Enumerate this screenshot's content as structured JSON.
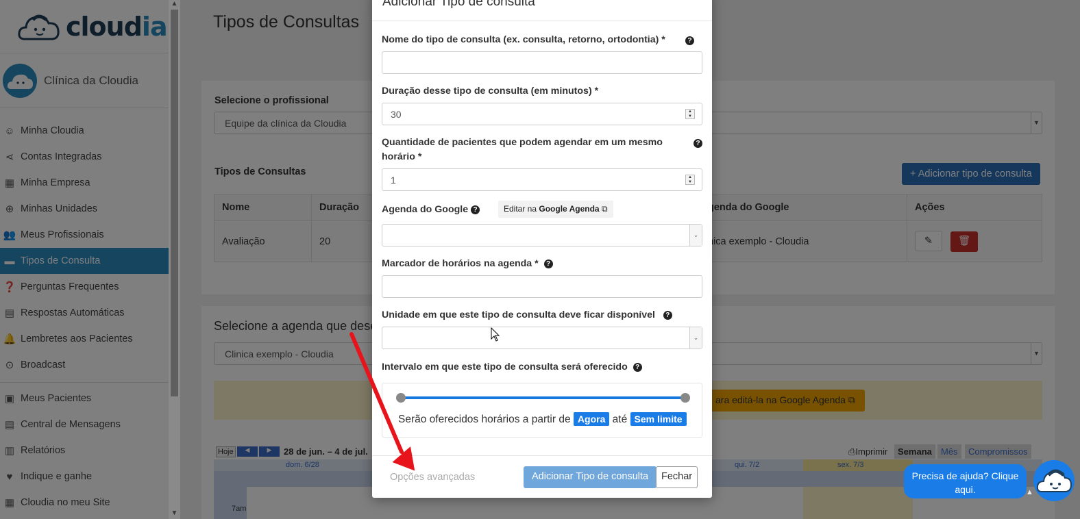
{
  "brand": {
    "name_a": "cloud",
    "name_b": "ia"
  },
  "clinic": {
    "name": "Clínica da Cloudia"
  },
  "menu": [
    {
      "label": "Minha Cloudia",
      "icon": "smiley-icon"
    },
    {
      "label": "Contas Integradas",
      "icon": "share-icon"
    },
    {
      "label": "Minha Empresa",
      "icon": "store-icon"
    },
    {
      "label": "Minhas Unidades",
      "icon": "plus-circle-icon"
    },
    {
      "label": "Meus Profissionais",
      "icon": "people-icon"
    },
    {
      "label": "Tipos de Consulta",
      "icon": "list-icon"
    },
    {
      "label": "Perguntas Frequentes",
      "icon": "question-icon"
    },
    {
      "label": "Respostas Automáticas",
      "icon": "chat-icon"
    },
    {
      "label": "Lembretes aos Pacientes",
      "icon": "bell-icon"
    },
    {
      "label": "Broadcast",
      "icon": "broadcast-icon"
    },
    {
      "label": "Meus Pacientes",
      "icon": "patients-icon"
    },
    {
      "label": "Central de Mensagens",
      "icon": "messages-icon"
    },
    {
      "label": "Relatórios",
      "icon": "chart-icon"
    },
    {
      "label": "Indique e ganhe",
      "icon": "heart-icon"
    },
    {
      "label": "Cloudia no meu Site",
      "icon": "site-icon"
    }
  ],
  "page": {
    "title": "Tipos de Consultas",
    "select_prof_label": "Selecione o profissional",
    "select_prof_value": "Equipe da clínica da Cloudia",
    "types_title": "Tipos de Consultas",
    "add_type_button": "Adicionar tipo de consulta",
    "table": {
      "headers": [
        "Nome",
        "Duração",
        "genda do Google",
        "Ações"
      ],
      "row": [
        "Avaliação",
        "20",
        "nica exemplo - Cloudia"
      ]
    },
    "agenda_label": "Selecione a agenda que dese",
    "agenda_value": "Clinica exemplo - Cloudia",
    "warn_text": "ara editá-la na Google Agenda",
    "cal": {
      "today": "Hoje",
      "range": "28 de jun. – 4 de jul.",
      "print": "Imprimir",
      "week": "Semana",
      "month": "Mês",
      "appointments": "Compromissos",
      "days": [
        "dom. 6/28",
        "qui. 7/2",
        "sex. 7/3"
      ],
      "time": "7am"
    }
  },
  "modal": {
    "title": "Adicionar Tipo de consulta",
    "name_label": "Nome do tipo de consulta (ex. consulta, retorno, ortodontia) *",
    "name_value": "",
    "duration_label": "Duração desse tipo de consulta (em minutos) *",
    "duration_value": "30",
    "qty_label_1": "Quantidade de pacientes que podem agendar em um mesmo",
    "qty_label_2": "horário *",
    "qty_value": "1",
    "google_label": "Agenda do Google",
    "google_edit_a": "Editar na",
    "google_edit_b": "Google Agenda",
    "marker_label": "Marcador de horários na agenda *",
    "unit_label": "Unidade em que este tipo de consulta deve ficar disponível",
    "interval_label": "Intervalo em que este tipo de consulta será oferecido",
    "interval_text_a": "Serão oferecidos horários a partir de",
    "interval_from": "Agora",
    "interval_text_b": "até",
    "interval_to": "Sem limite",
    "advanced": "Opções avançadas",
    "submit": "Adicionar Tipo de consulta",
    "close": "Fechar",
    "help_q": "?"
  },
  "help": {
    "text": "Precisa de ajuda? Clique aqui."
  },
  "colors": {
    "accent": "#2a8bbf",
    "primary": "#1a7ce6",
    "danger": "#c9302c",
    "arrow": "#e8141b"
  }
}
